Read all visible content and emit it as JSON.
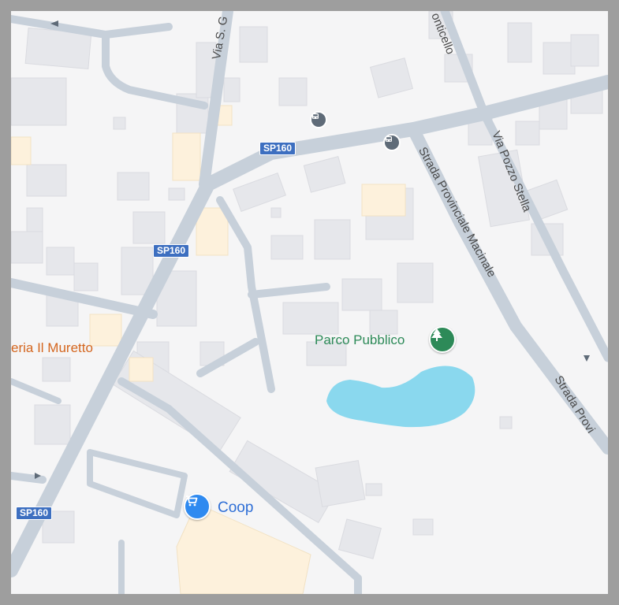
{
  "map": {
    "roads": {
      "via_s": "Via S. G",
      "monticello": "onticello",
      "via_pozzo_stella": "Via Pozzo Stella",
      "strada_provinciale_macinale": "Strada Provinciale Macinale",
      "strada_provi": "Strada Provi"
    },
    "shields": {
      "s1": "SP160",
      "s2": "SP160",
      "s3": "SP160"
    },
    "pois": {
      "parco": "Parco Pubblico",
      "muretto": "eria Il Muretto",
      "coop": "Coop"
    },
    "icons": {
      "park": "tree-icon",
      "coop": "shopping-cart-icon",
      "bus": "bus-stop-icon"
    },
    "colors": {
      "background": "#f5f5f6",
      "road": "#c7d0da",
      "building": "#e6e7eb",
      "commercial": "#fdf1dc",
      "water": "#8ad8ee",
      "shield": "#3d6fc0",
      "park_pin": "#2d8a58",
      "shop_pin": "#2f8af0"
    }
  }
}
